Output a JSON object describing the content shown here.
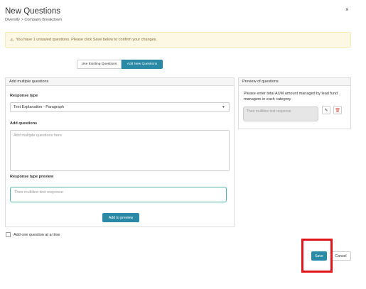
{
  "modal": {
    "title": "New Questions",
    "breadcrumb": "Diversity > Company Breakdown",
    "close_label": "×"
  },
  "alert": {
    "icon": "warning-icon",
    "text": "You have 1 unsaved questions. Please click Save below to confirm your changes."
  },
  "tabs": {
    "existing": "Use Existing Questions",
    "add_new": "Add New Questions",
    "active": "add_new"
  },
  "add_panel": {
    "heading": "Add multiple questions",
    "response_type_label": "Response type",
    "response_type_value": "Text Explanation - Paragraph",
    "add_questions_label": "Add questions",
    "add_questions_placeholder": "Add multiple questions here",
    "preview_label": "Response type preview",
    "preview_placeholder": "Their multiline text response",
    "add_to_preview": "Add to preview"
  },
  "preview_panel": {
    "heading": "Preview of questions",
    "question_text": "Please enter total AUM amount managed by lead fund managers in each category",
    "question_response_placeholder": "Their multiline text response"
  },
  "options": {
    "one_at_a_time": "Add one question at a time",
    "one_at_a_time_checked": false
  },
  "footer": {
    "save": "Save",
    "cancel": "Cancel"
  },
  "colors": {
    "primary": "#2a8aa5",
    "highlight": "#e0161d",
    "alert_bg": "#fcf8e3",
    "delete": "#d9534f"
  }
}
